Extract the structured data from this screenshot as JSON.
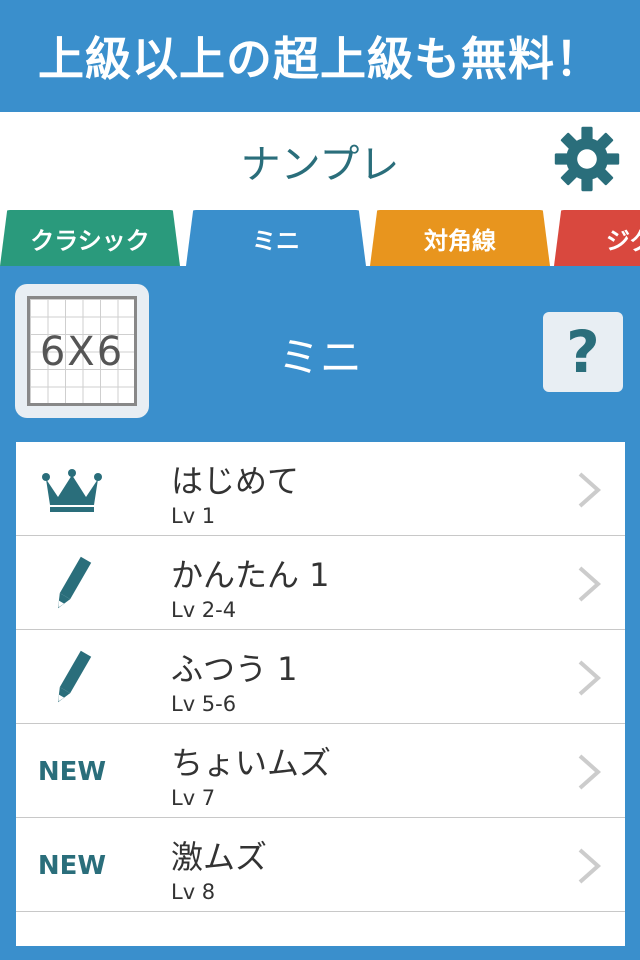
{
  "banner": {
    "text": "上級以上の超上級も無料！"
  },
  "header": {
    "title": "ナンプレ"
  },
  "tabs": [
    {
      "label": "クラシック",
      "color": "#2a9a7c"
    },
    {
      "label": "ミニ",
      "color": "#3a8fcc",
      "selected": true
    },
    {
      "label": "対角線",
      "color": "#e8951e"
    },
    {
      "label": "ジグ",
      "color": "#d9483e"
    }
  ],
  "section": {
    "board_label": "6X6",
    "title": "ミニ",
    "help_label": "?"
  },
  "levels": [
    {
      "icon": "crown-icon",
      "badge": "",
      "title": "はじめて",
      "level": "Lv 1"
    },
    {
      "icon": "pencil-icon",
      "badge": "",
      "title": "かんたん 1",
      "level": "Lv 2-4"
    },
    {
      "icon": "pencil-icon",
      "badge": "",
      "title": "ふつう 1",
      "level": "Lv 5-6"
    },
    {
      "icon": "new-badge",
      "badge": "NEW",
      "title": "ちょいムズ",
      "level": "Lv  7"
    },
    {
      "icon": "new-badge",
      "badge": "NEW",
      "title": "激ムズ",
      "level": "Lv  8"
    }
  ],
  "colors": {
    "primary": "#3a8fcc",
    "accent": "#2a6e7b"
  }
}
